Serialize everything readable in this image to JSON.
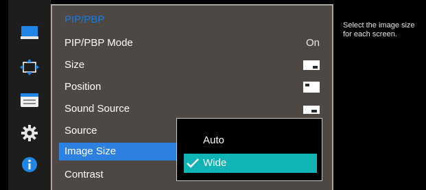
{
  "menu": {
    "title": "PIP/PBP",
    "items": [
      {
        "label": "PIP/PBP Mode",
        "value": "On"
      },
      {
        "label": "Size",
        "icon": "size-large-icon"
      },
      {
        "label": "Position",
        "icon": "position-top-left-icon"
      },
      {
        "label": "Sound Source",
        "icon": "sound-source-icon"
      },
      {
        "label": "Source"
      },
      {
        "label": "Image Size",
        "selected": true
      },
      {
        "label": "Contrast"
      }
    ]
  },
  "submenu": {
    "options": [
      {
        "label": "Auto",
        "checked": false
      },
      {
        "label": "Wide",
        "checked": true
      }
    ]
  },
  "help": {
    "text": "Select the image size\nfor each screen."
  },
  "sidebar_icons": [
    "picture-icon",
    "onscreen-display-icon",
    "system-settings-icon",
    "gear-icon",
    "info-icon"
  ],
  "colors": {
    "menu_bg": "#4d4844",
    "title": "#1e7ad8",
    "selected_row": "#2d7fe0",
    "submenu_active": "#11b4b4"
  }
}
